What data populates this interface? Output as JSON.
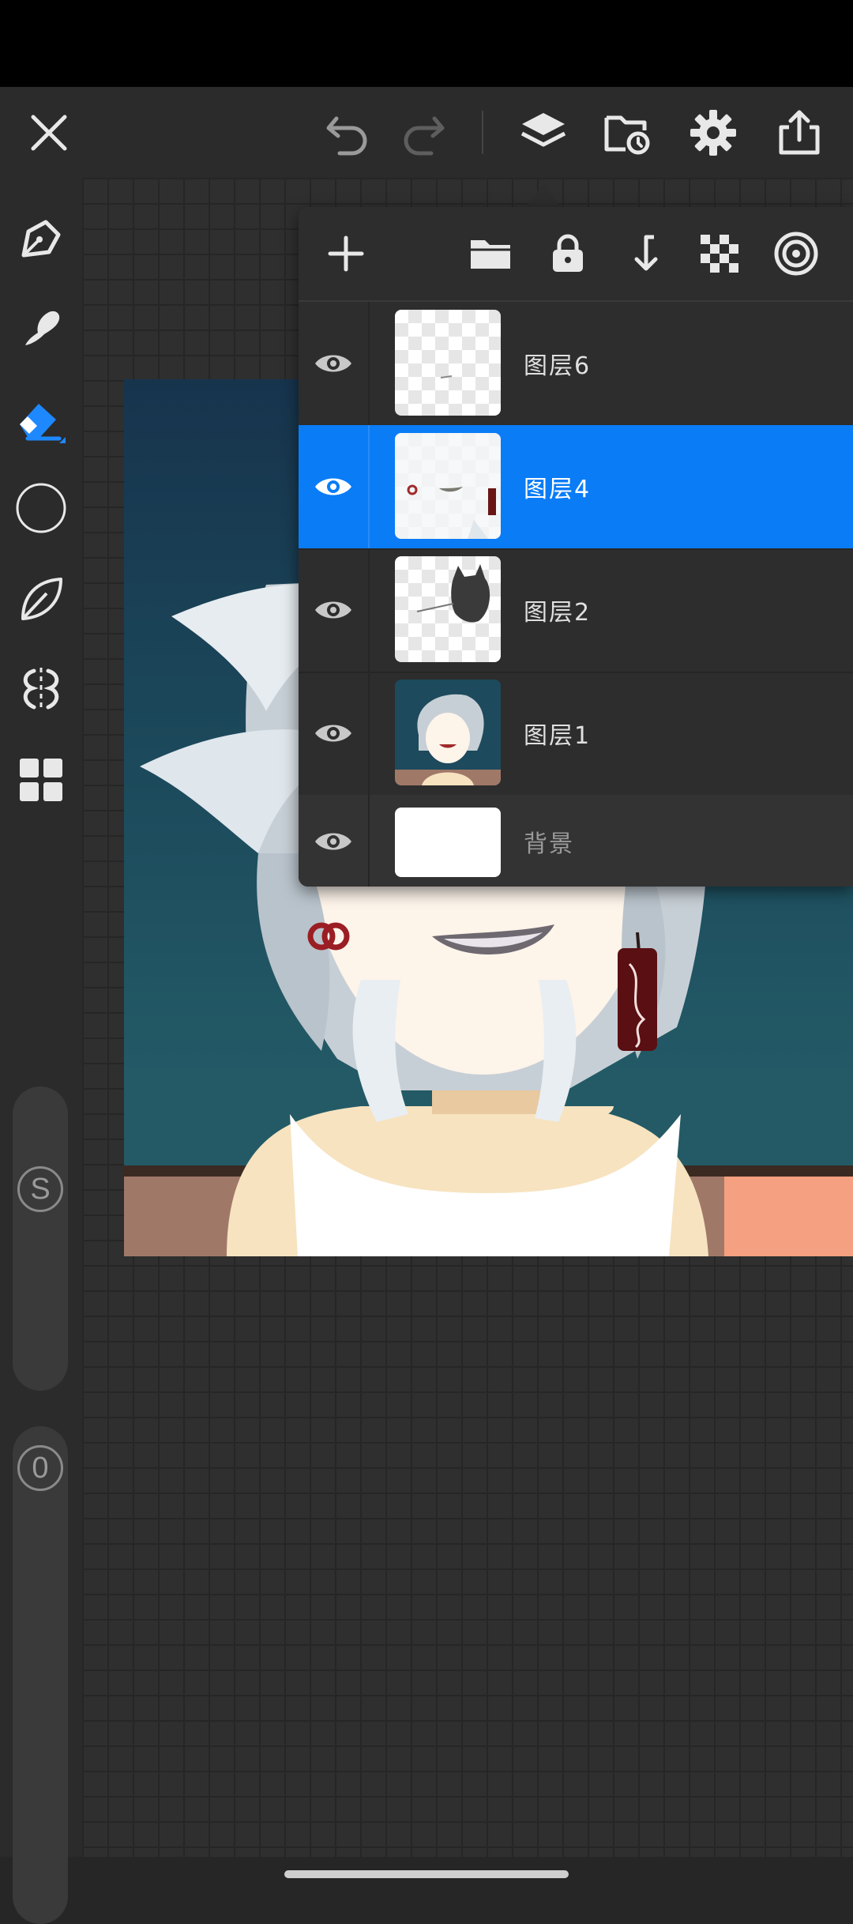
{
  "toolbar": {
    "close_icon": "close-icon",
    "undo_icon": "undo-icon",
    "redo_icon": "redo-icon",
    "layers_icon": "layers-icon",
    "gallery_icon": "gallery-folder-icon",
    "settings_icon": "gear-icon",
    "export_icon": "export-icon"
  },
  "tools": [
    {
      "name": "pen",
      "icon": "pen-nib-icon",
      "active": false
    },
    {
      "name": "smudge",
      "icon": "smudge-finger-icon",
      "active": false
    },
    {
      "name": "eraser",
      "icon": "eraser-icon",
      "active": true
    },
    {
      "name": "shape",
      "icon": "circle-shape-icon",
      "active": false
    },
    {
      "name": "fill",
      "icon": "leaf-icon",
      "active": false
    },
    {
      "name": "symmetry",
      "icon": "symmetry-icon",
      "active": false
    },
    {
      "name": "more",
      "icon": "grid-tools-icon",
      "active": false
    }
  ],
  "sliders": {
    "size_label": "S",
    "opacity_label": "0"
  },
  "layers_panel": {
    "header_icons": [
      "add-layer-icon",
      "folder-icon",
      "lock-icon",
      "merge-down-icon",
      "transparency-icon",
      "blend-icon"
    ],
    "layers": [
      {
        "name": "图层6",
        "visible": true,
        "selected": false
      },
      {
        "name": "图层4",
        "visible": true,
        "selected": true
      },
      {
        "name": "图层2",
        "visible": true,
        "selected": false
      },
      {
        "name": "图层1",
        "visible": true,
        "selected": false
      }
    ],
    "background": {
      "name": "背景",
      "visible": true
    }
  },
  "colors": {
    "accent": "#0a7cf6",
    "toolbar_bg": "#2b2b2b",
    "panel_bg": "#2d2d2d",
    "icon": "#e8e8e8"
  }
}
